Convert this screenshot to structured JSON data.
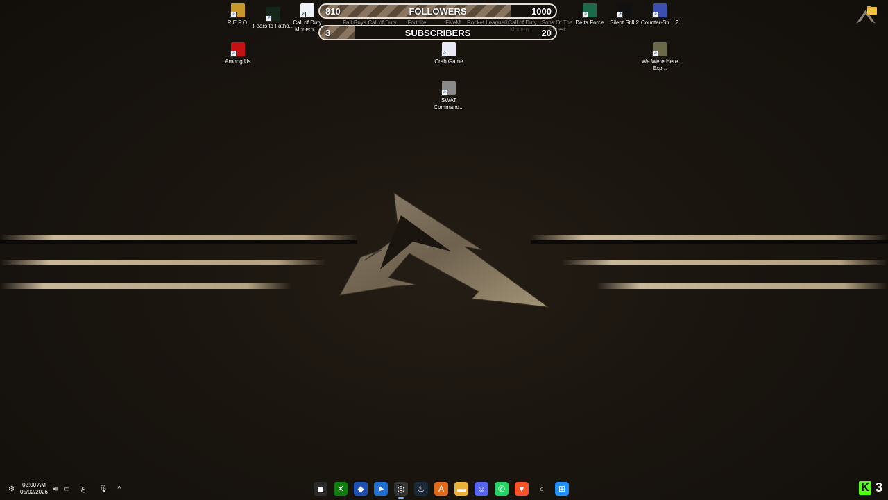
{
  "desktop_icons": [
    {
      "label": "R.E.P.O.",
      "icon": "repo-icon",
      "color": "#c9962a"
    },
    {
      "label": "Fears to Fatho...",
      "icon": "fears-to-fathom-icon",
      "color": "#15261a"
    },
    {
      "label": "Call of Duty Modern ...",
      "icon": "document-icon",
      "color": "#eef2f8"
    },
    {
      "label": "Delta Force",
      "icon": "delta-force-icon",
      "color": "#1d6a4a"
    },
    {
      "label": "Silent Still 2",
      "icon": "silent-still-icon",
      "color": "#111111"
    },
    {
      "label": "Counter-Str... 2",
      "icon": "counter-strike-icon",
      "color": "#3a4fb0"
    },
    {
      "label": "Among Us",
      "icon": "among-us-icon",
      "color": "#c51111"
    },
    {
      "label": "We Were Here Exp...",
      "icon": "we-were-here-icon",
      "color": "#6a6a4a"
    },
    {
      "label": "Crab Game",
      "icon": "crab-game-icon",
      "color": "#e9e9f5"
    },
    {
      "label": "SWAT Command...",
      "icon": "swat-icon",
      "color": "#8a8a8a"
    }
  ],
  "hidden_icon_labels": [
    "Fall Guys",
    "Call of Duty",
    "Fortnite",
    "FiveM",
    "Rocket League®",
    "Call of Duty Modern ...",
    "Sons Of The Forest"
  ],
  "overlay": {
    "followers": {
      "title": "FOLLOWERS",
      "current": "810",
      "goal": "1000",
      "progress": 0.81
    },
    "subscribers": {
      "title": "SUBSCRIBERS",
      "current": "3",
      "goal": "20",
      "progress": 0.15
    }
  },
  "taskbar": {
    "time": "02:00 AM",
    "date": "05/02/2026",
    "lang": "ع",
    "apps": [
      {
        "name": "media-app-icon",
        "glyph": "◼",
        "bg": "#2b2b2b"
      },
      {
        "name": "xbox-icon",
        "glyph": "✕",
        "bg": "#107c10"
      },
      {
        "name": "gem-app-icon",
        "glyph": "◆",
        "bg": "#1e4fb5"
      },
      {
        "name": "edge-dev-icon",
        "glyph": "➤",
        "bg": "#1f6fd1"
      },
      {
        "name": "chrome-like-icon",
        "glyph": "◎",
        "bg": "#333333"
      },
      {
        "name": "steam-icon",
        "glyph": "♨",
        "bg": "#1b2838"
      },
      {
        "name": "app-a-icon",
        "glyph": "A",
        "bg": "#e06a1c"
      },
      {
        "name": "folder-icon",
        "glyph": "▬",
        "bg": "#e8b23a"
      },
      {
        "name": "discord-icon",
        "glyph": "☺",
        "bg": "#5865f2"
      },
      {
        "name": "whatsapp-icon",
        "glyph": "✆",
        "bg": "#25d366"
      },
      {
        "name": "brave-icon",
        "glyph": "▼",
        "bg": "#fb542b"
      },
      {
        "name": "search-icon",
        "glyph": "⌕",
        "bg": "transparent"
      },
      {
        "name": "windows-start-icon",
        "glyph": "⊞",
        "bg": "#1e90ff"
      }
    ],
    "kick_label": "K",
    "kick_count": "3"
  }
}
